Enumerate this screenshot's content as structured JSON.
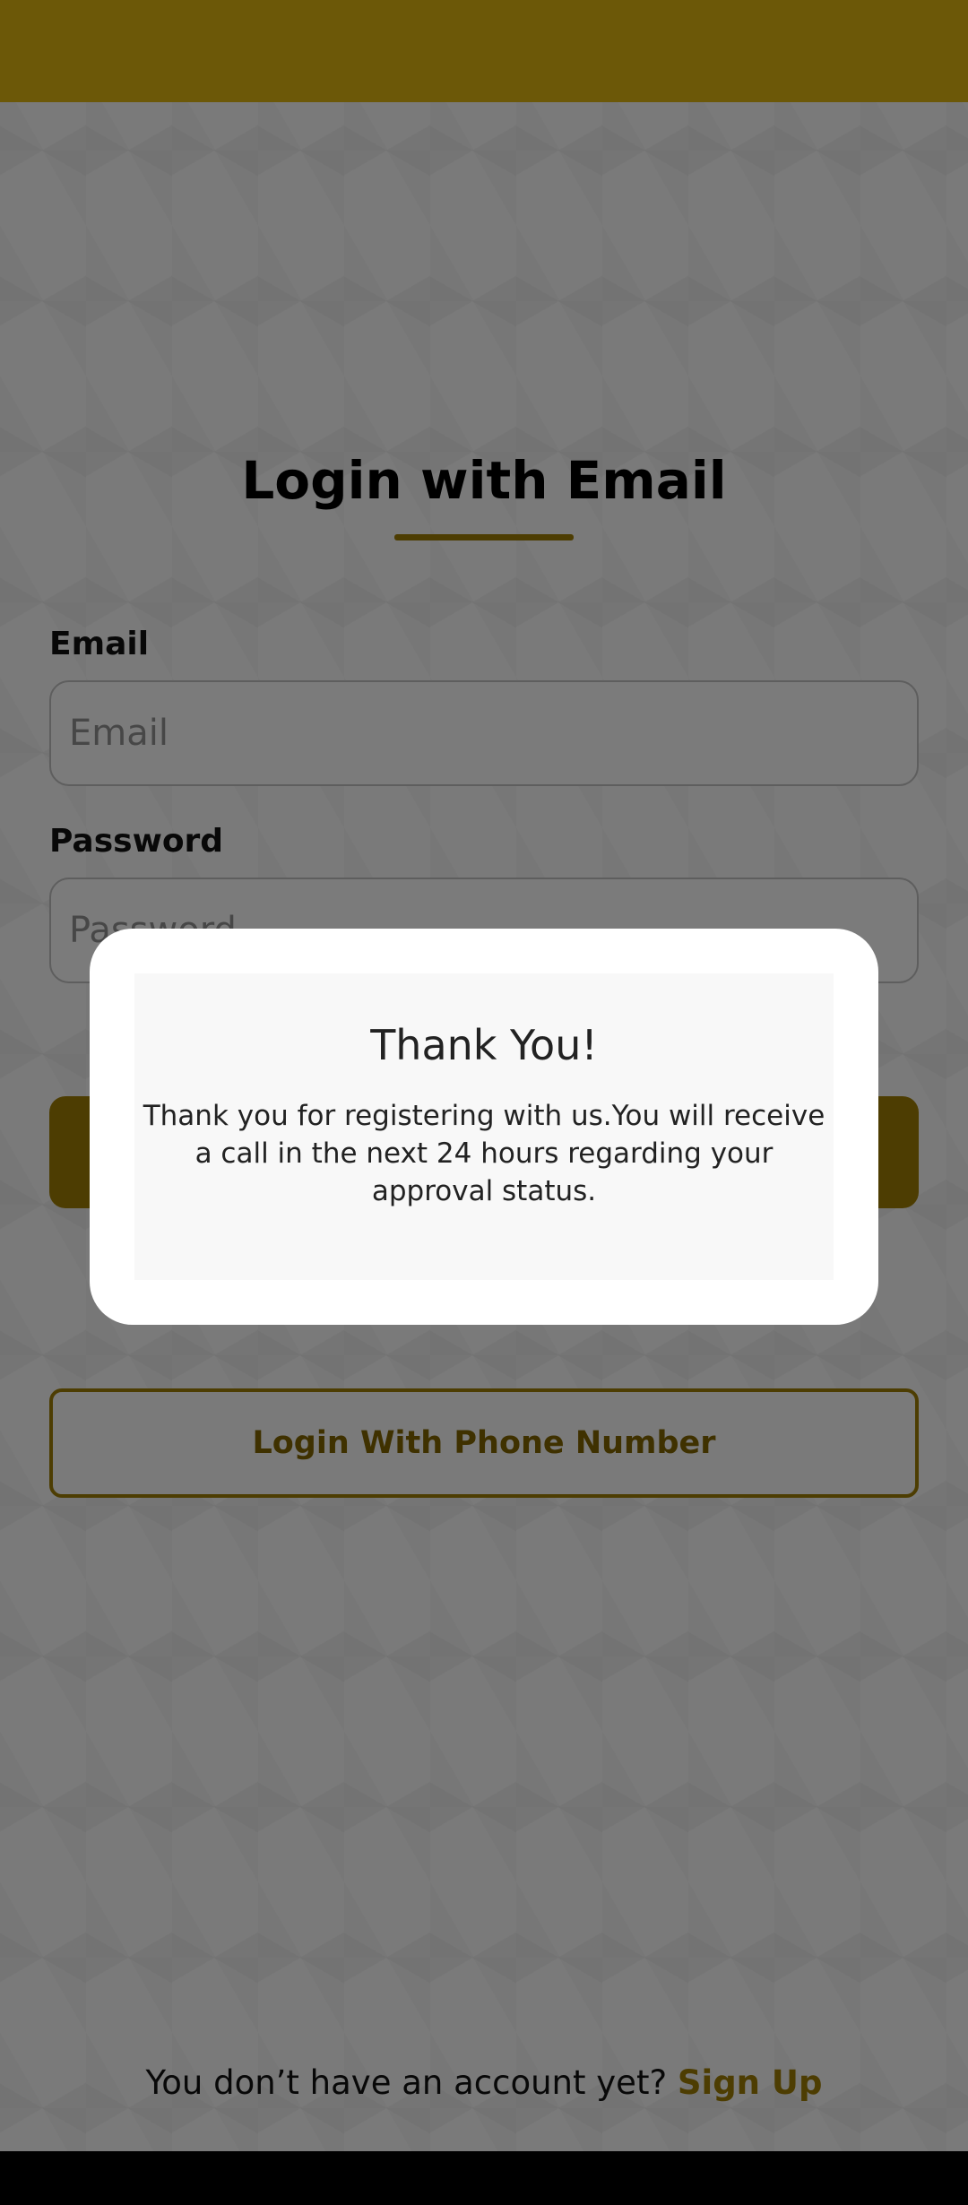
{
  "login": {
    "title": "Login with Email",
    "email_label": "Email",
    "email_placeholder": "Email",
    "password_label": "Password",
    "password_placeholder": "Password",
    "login_button_label": "",
    "phone_button_label": "Login With Phone Number",
    "signup_prompt": "You don’t have an account yet?",
    "signup_link": "Sign Up"
  },
  "dialog": {
    "title": "Thank You!",
    "message": "Thank you for registering with us.You will receive a call in the next 24 hours regarding your approval status."
  },
  "colors": {
    "status_bar": "#d9b010",
    "accent": "#9b7a05",
    "overlay": "rgba(0,0,0,0.5)"
  }
}
